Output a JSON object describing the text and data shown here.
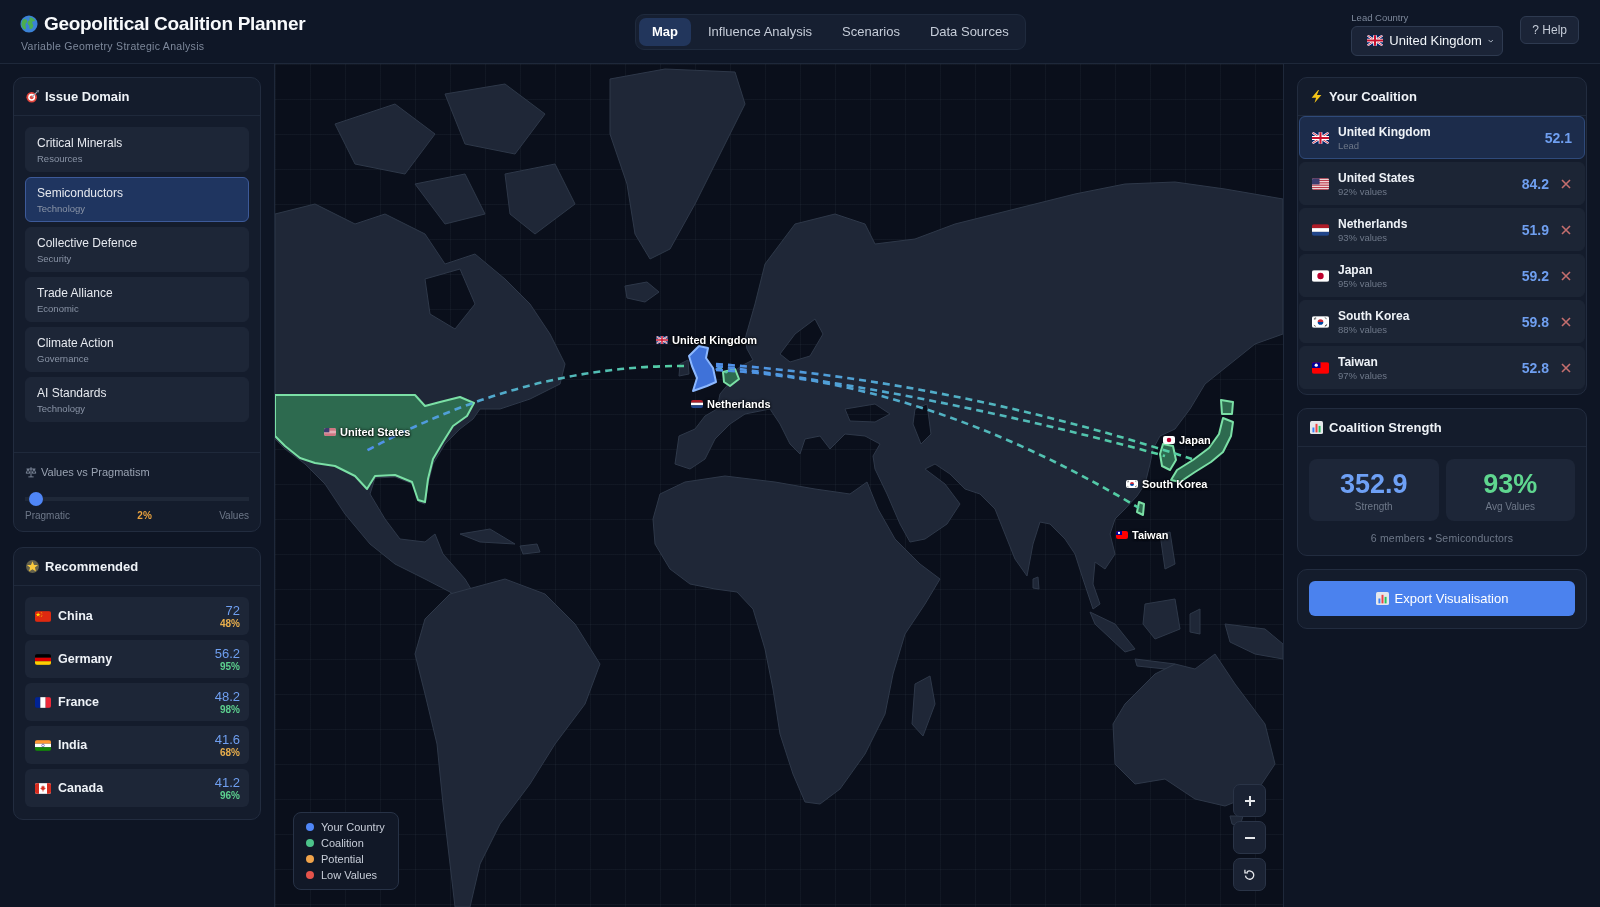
{
  "header": {
    "title": "Geopolitical Coalition Planner",
    "subtitle": "Variable Geometry Strategic Analysis"
  },
  "tabs": [
    {
      "label": "Map",
      "selected": true
    },
    {
      "label": "Influence Analysis",
      "selected": false
    },
    {
      "label": "Scenarios",
      "selected": false
    },
    {
      "label": "Data Sources",
      "selected": false
    }
  ],
  "lead_country": {
    "label": "Lead Country",
    "value": "United Kingdom",
    "kind": "gb"
  },
  "help_button": {
    "label": "? Help"
  },
  "issue_domain": {
    "title": "Issue Domain",
    "items": [
      {
        "name": "Critical Minerals",
        "category": "Resources",
        "selected": false
      },
      {
        "name": "Semiconductors",
        "category": "Technology",
        "selected": true
      },
      {
        "name": "Collective Defence",
        "category": "Security",
        "selected": false
      },
      {
        "name": "Trade Alliance",
        "category": "Economic",
        "selected": false
      },
      {
        "name": "Climate Action",
        "category": "Governance",
        "selected": false
      },
      {
        "name": "AI Standards",
        "category": "Technology",
        "selected": false
      }
    ]
  },
  "values_slider": {
    "title": "Values vs Pragmatism",
    "level": 0.02,
    "min_label": "Pragmatic",
    "reading": "2%",
    "max_label": "Values"
  },
  "recommended": {
    "title": "Recommended",
    "items": [
      {
        "name": "China",
        "kind": "cn",
        "score": "72",
        "values": "48%",
        "color": "#e8ae4c"
      },
      {
        "name": "Germany",
        "kind": "de",
        "score": "56.2",
        "values": "95%",
        "color": "#5ccf8e"
      },
      {
        "name": "France",
        "kind": "fr",
        "score": "48.2",
        "values": "98%",
        "color": "#5ccf8e"
      },
      {
        "name": "India",
        "kind": "in",
        "score": "41.6",
        "values": "68%",
        "color": "#e8ae4c"
      },
      {
        "name": "Canada",
        "kind": "ca",
        "score": "41.2",
        "values": "96%",
        "color": "#5ccf8e"
      }
    ]
  },
  "map": {
    "countries": [
      {
        "name": "United Kingdom",
        "kind": "gb",
        "lead": true
      },
      {
        "name": "United States",
        "kind": "us",
        "lead": false
      },
      {
        "name": "Netherlands",
        "kind": "nl",
        "lead": false
      },
      {
        "name": "Japan",
        "kind": "jp",
        "lead": false
      },
      {
        "name": "South Korea",
        "kind": "kr",
        "lead": false
      },
      {
        "name": "Taiwan",
        "kind": "tw",
        "lead": false
      }
    ],
    "legend": [
      {
        "label": "Your Country",
        "color": "#4f86f7"
      },
      {
        "label": "Coalition",
        "color": "#4cc38a"
      },
      {
        "label": "Potential",
        "color": "#f0a34a"
      },
      {
        "label": "Low Values",
        "color": "#e5534b"
      }
    ]
  },
  "coalition": {
    "title": "Your Coalition",
    "members": [
      {
        "name": "United Kingdom",
        "kind": "gb",
        "detail": "Lead",
        "score": "52.1",
        "lead": true
      },
      {
        "name": "United States",
        "kind": "us",
        "detail": "92% values",
        "score": "84.2",
        "lead": false
      },
      {
        "name": "Netherlands",
        "kind": "nl",
        "detail": "93% values",
        "score": "51.9",
        "lead": false
      },
      {
        "name": "Japan",
        "kind": "jp",
        "detail": "95% values",
        "score": "59.2",
        "lead": false
      },
      {
        "name": "South Korea",
        "kind": "kr",
        "detail": "88% values",
        "score": "59.8",
        "lead": false
      },
      {
        "name": "Taiwan",
        "kind": "tw",
        "detail": "97% values",
        "score": "52.8",
        "lead": false
      }
    ]
  },
  "strength": {
    "title": "Coalition Strength",
    "stats": [
      {
        "value": "352.9",
        "label": "Strength",
        "kind": "strength"
      },
      {
        "value": "93%",
        "label": "Avg Values",
        "kind": "values"
      }
    ],
    "summary": "6 members • Semiconductors"
  },
  "export_button": {
    "label": "Export Visualisation"
  }
}
